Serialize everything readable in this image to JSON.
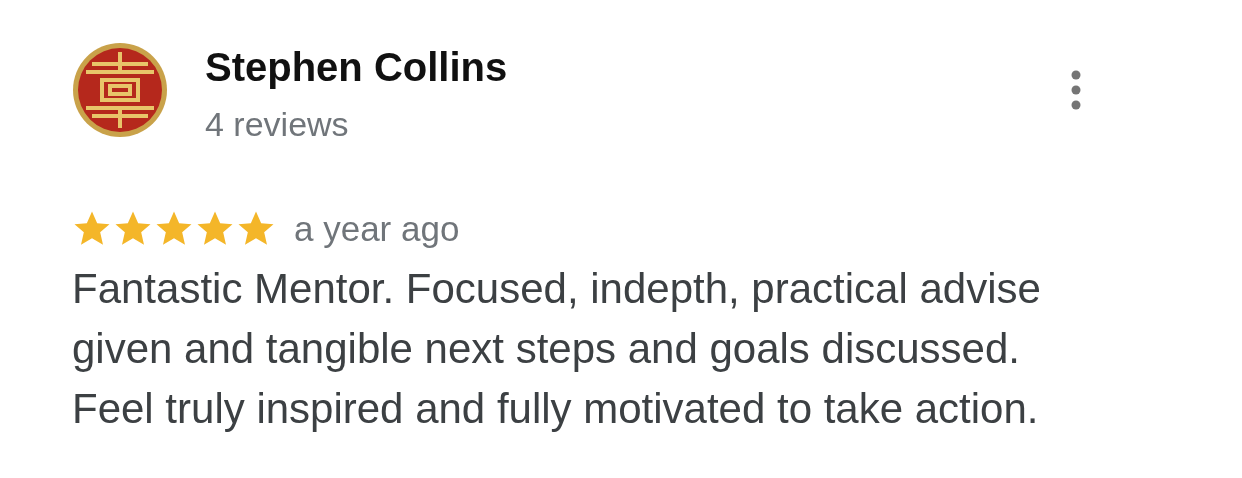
{
  "reviewer": {
    "name": "Stephen Collins",
    "review_count": "4 reviews"
  },
  "review": {
    "stars": 5,
    "time": "a year ago",
    "text": "Fantastic Mentor. Focused, indepth, practical advise given and tangible next steps and goals discussed. Feel truly inspired and fully motivated to take action."
  }
}
